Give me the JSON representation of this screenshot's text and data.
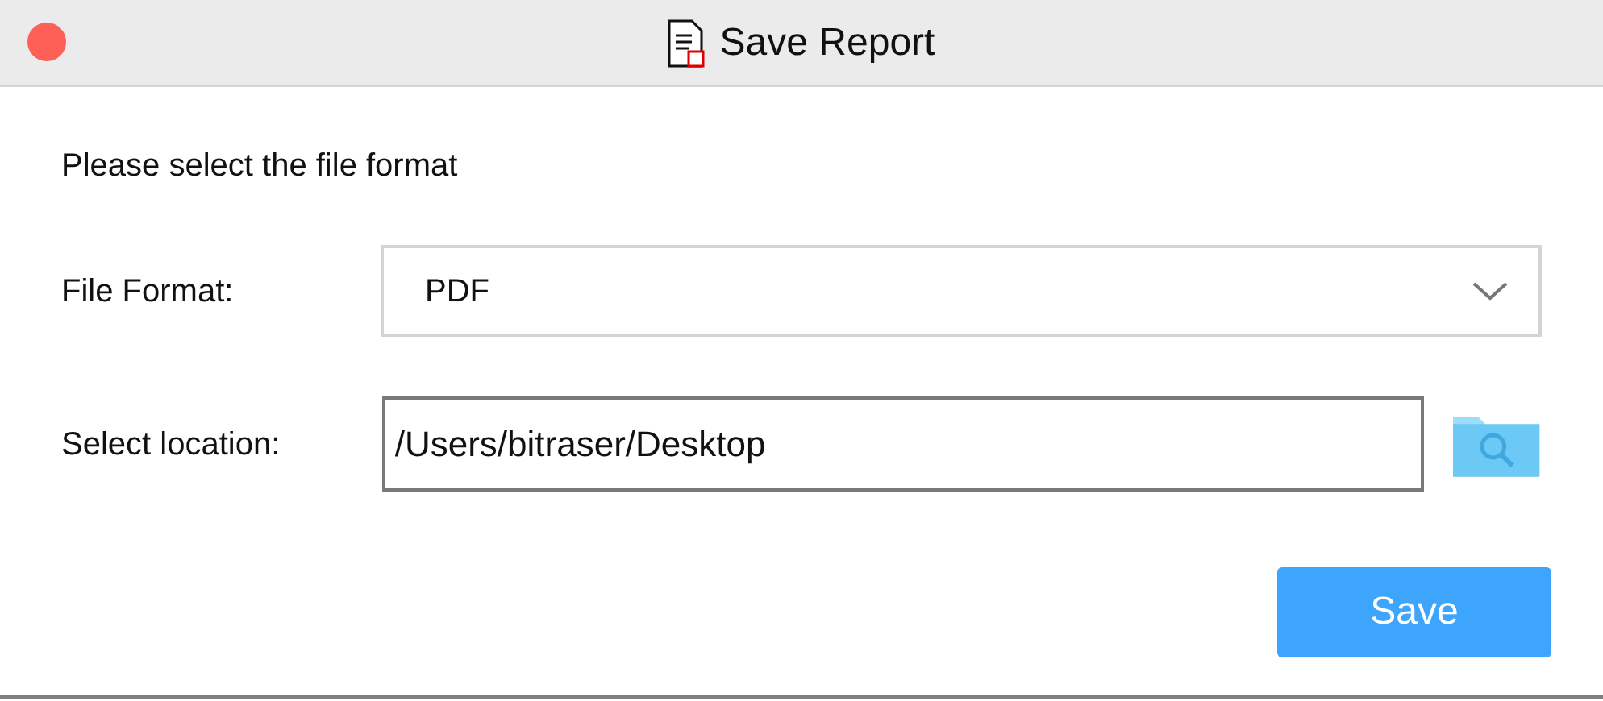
{
  "window": {
    "title": "Save Report"
  },
  "prompt": "Please select the file format",
  "file_format": {
    "label": "File Format:",
    "value": "PDF"
  },
  "location": {
    "label": "Select location:",
    "value": "/Users/bitraser/Desktop"
  },
  "buttons": [
    "Save"
  ]
}
